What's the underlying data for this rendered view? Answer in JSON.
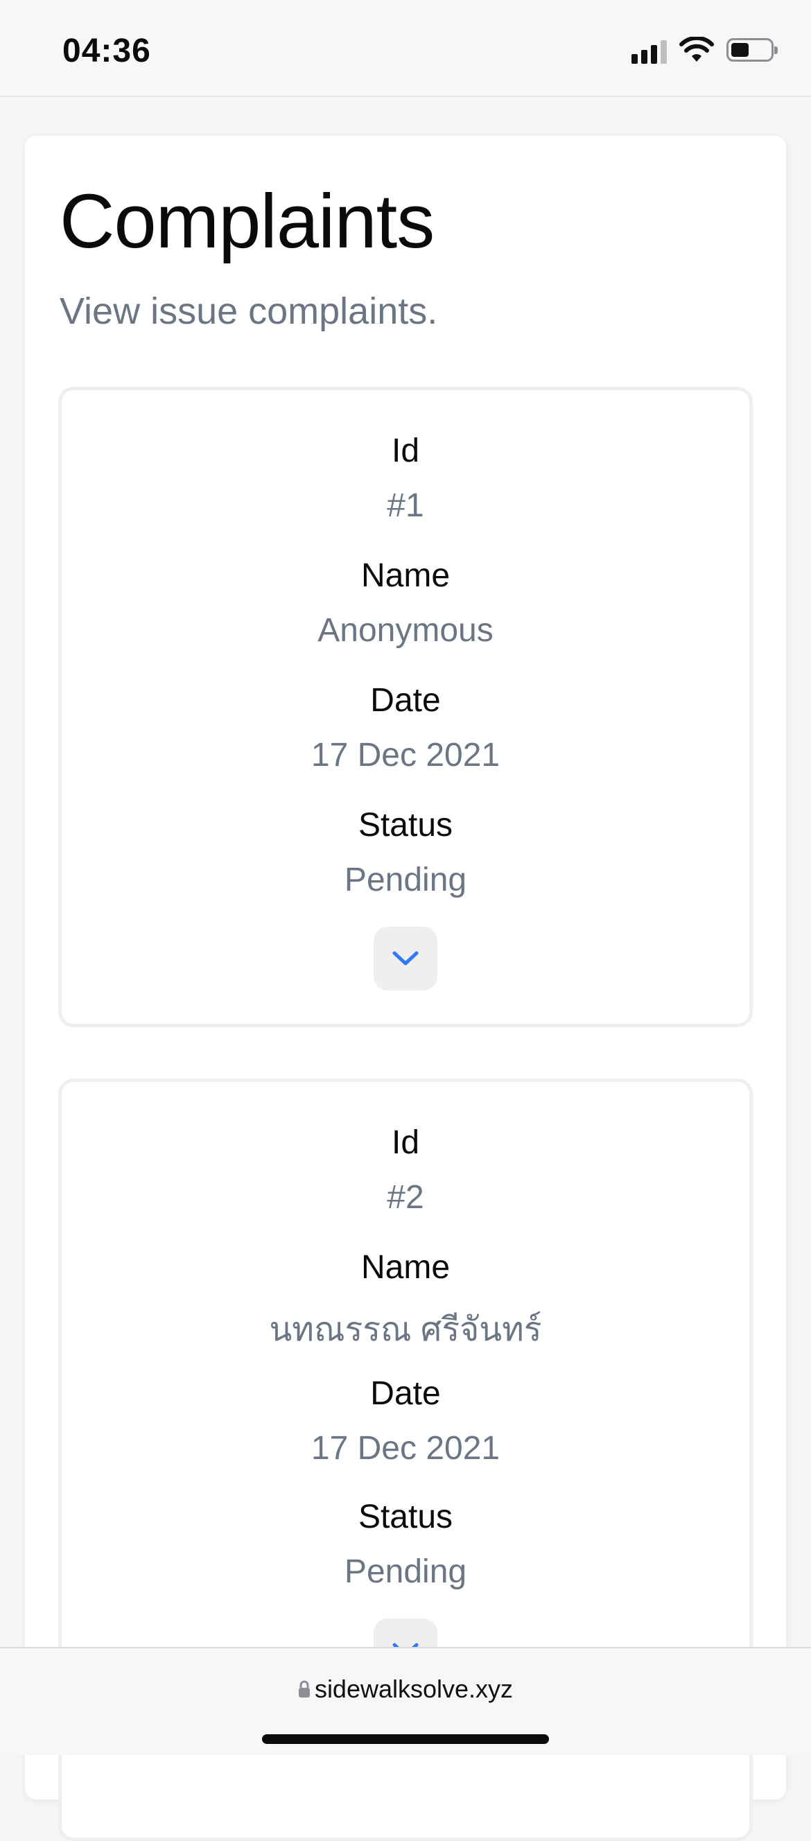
{
  "status_bar": {
    "time": "04:36",
    "battery_level": 0.45
  },
  "page": {
    "title": "Complaints",
    "subtitle": "View issue complaints."
  },
  "labels": {
    "id": "Id",
    "name": "Name",
    "date": "Date",
    "status": "Status"
  },
  "complaints": [
    {
      "id": "#1",
      "name": "Anonymous",
      "date": "17 Dec 2021",
      "status": "Pending"
    },
    {
      "id": "#2",
      "name": "นทณรรณ ศรีจันทร์",
      "date": "17 Dec 2021",
      "status": "Pending"
    }
  ],
  "browser": {
    "url": "sidewalksolve.xyz"
  },
  "colors": {
    "accent": "#3478f6",
    "muted_text": "#6b7584"
  },
  "icons": {
    "expand": "chevron-down-icon",
    "lock": "lock-icon",
    "wifi": "wifi-icon",
    "signal": "signal-icon",
    "battery": "battery-icon"
  }
}
